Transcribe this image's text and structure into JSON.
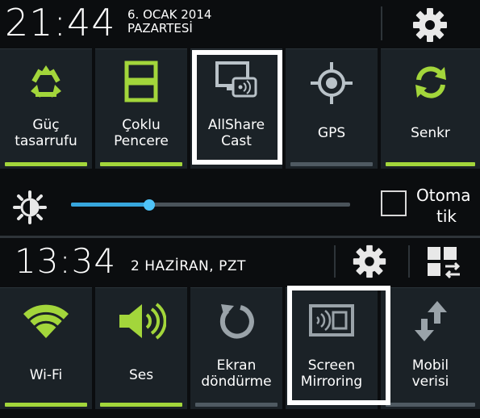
{
  "colors": {
    "accent_on": "#a3d63b",
    "accent_off": "#4f5a62",
    "slider": "#37a6dd",
    "highlight": "#ffffff"
  },
  "panel_top": {
    "time": "21:44",
    "date_line1": "6. OCAK 2014",
    "date_line2": "PAZARTESİ",
    "settings_icon": "gear-icon",
    "toggles": [
      {
        "label1": "Güç",
        "label2": "tasarrufu",
        "icon": "recycle-icon",
        "state": "on"
      },
      {
        "label1": "Çoklu",
        "label2": "Pencere",
        "icon": "multi-window-icon",
        "state": "on"
      },
      {
        "label1": "AllShare",
        "label2": "Cast",
        "icon": "cast-icon",
        "state": "off",
        "highlighted": true
      },
      {
        "label1": "GPS",
        "label2": "",
        "icon": "gps-icon",
        "state": "off"
      },
      {
        "label1": "Senkr",
        "label2": "",
        "icon": "sync-icon",
        "state": "on"
      }
    ],
    "brightness": {
      "level": 0.28,
      "auto_label_1": "Otoma",
      "auto_label_2": "tik",
      "auto_checked": false
    }
  },
  "panel_bottom": {
    "time": "13:34",
    "date": "2 HAZİRAN, PZT",
    "settings_icon": "gear-icon",
    "grid_icon": "edit-grid-icon",
    "toggles": [
      {
        "label1": "Wi-Fi",
        "label2": "",
        "icon": "wifi-icon",
        "state": "on"
      },
      {
        "label1": "Ses",
        "label2": "",
        "icon": "speaker-icon",
        "state": "on"
      },
      {
        "label1": "Ekran",
        "label2": "döndürme",
        "icon": "rotate-icon",
        "state": "off"
      },
      {
        "label1": "Screen",
        "label2": "Mirroring",
        "icon": "screen-mirroring-icon",
        "state": "off",
        "highlighted": true
      },
      {
        "label1": "Mobil",
        "label2": "verisi",
        "icon": "mobile-data-icon",
        "state": "off"
      }
    ]
  }
}
